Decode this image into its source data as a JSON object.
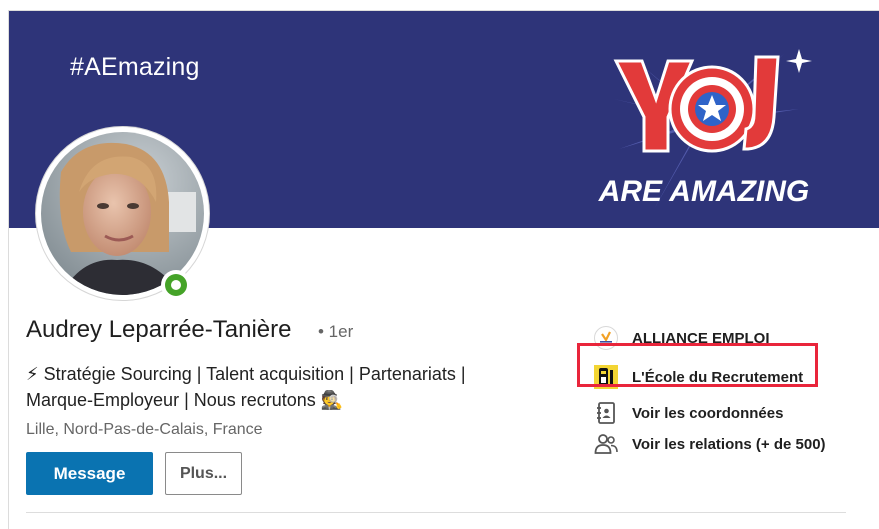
{
  "banner": {
    "hashtag": "#AEmazing",
    "logo_text_top": "YOU",
    "logo_text_bottom": "ARE AMAZING",
    "background_color": "#2e3479"
  },
  "profile": {
    "name": "Audrey Leparrée-Tanière",
    "degree": "• 1er",
    "headline_line1": "⚡ Stratégie Sourcing | Talent acquisition | Partenariats |",
    "headline_line2": "Marque-Employeur | Nous recrutons 🕵",
    "location": "Lille, Nord-Pas-de-Calais, France",
    "presence": "online"
  },
  "actions": {
    "message_label": "Message",
    "more_label": "Plus..."
  },
  "sidebar": {
    "items": [
      {
        "label": "ALLIANCE EMPLOI",
        "icon": "alliance-emploi-logo"
      },
      {
        "label": "L'École du Recrutement",
        "icon": "ecole-du-recrutement-logo"
      },
      {
        "label": "Voir les coordonnées",
        "icon": "contact-card-icon"
      },
      {
        "label": "Voir les relations (+ de 500)",
        "icon": "people-icon"
      }
    ]
  },
  "colors": {
    "primary_button": "#0a73b1",
    "highlight_border": "#e9253b",
    "presence": "#45a328"
  }
}
